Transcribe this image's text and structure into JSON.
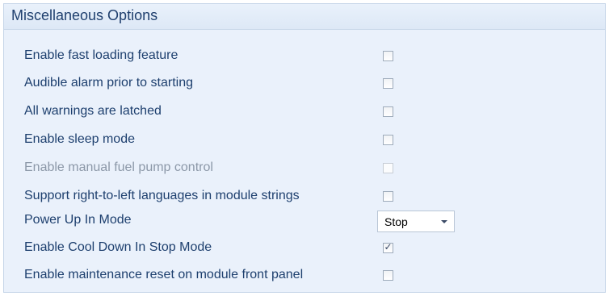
{
  "panel": {
    "title": "Miscellaneous Options"
  },
  "options": [
    {
      "label": "Enable fast loading feature",
      "checked": false,
      "disabled": false
    },
    {
      "label": "Audible alarm prior to starting",
      "checked": false,
      "disabled": false
    },
    {
      "label": "All warnings are latched",
      "checked": false,
      "disabled": false
    },
    {
      "label": "Enable sleep mode",
      "checked": false,
      "disabled": false
    },
    {
      "label": "Enable manual fuel pump control",
      "checked": false,
      "disabled": true
    },
    {
      "label": "Support right-to-left languages in module strings",
      "checked": false,
      "disabled": false
    },
    {
      "label": "Power Up In Mode",
      "select_value": "Stop"
    },
    {
      "label": "Enable Cool Down In Stop Mode",
      "checked": true,
      "disabled": false
    },
    {
      "label": "Enable maintenance reset on module front panel",
      "checked": false,
      "disabled": false
    }
  ],
  "icons": {
    "dropdown": "chevron-down-icon",
    "checkmark": "check-icon"
  },
  "colors": {
    "panel_bg": "#eaf1fb",
    "label_text": "#1d3f6e",
    "disabled_text": "#8c98a8"
  }
}
